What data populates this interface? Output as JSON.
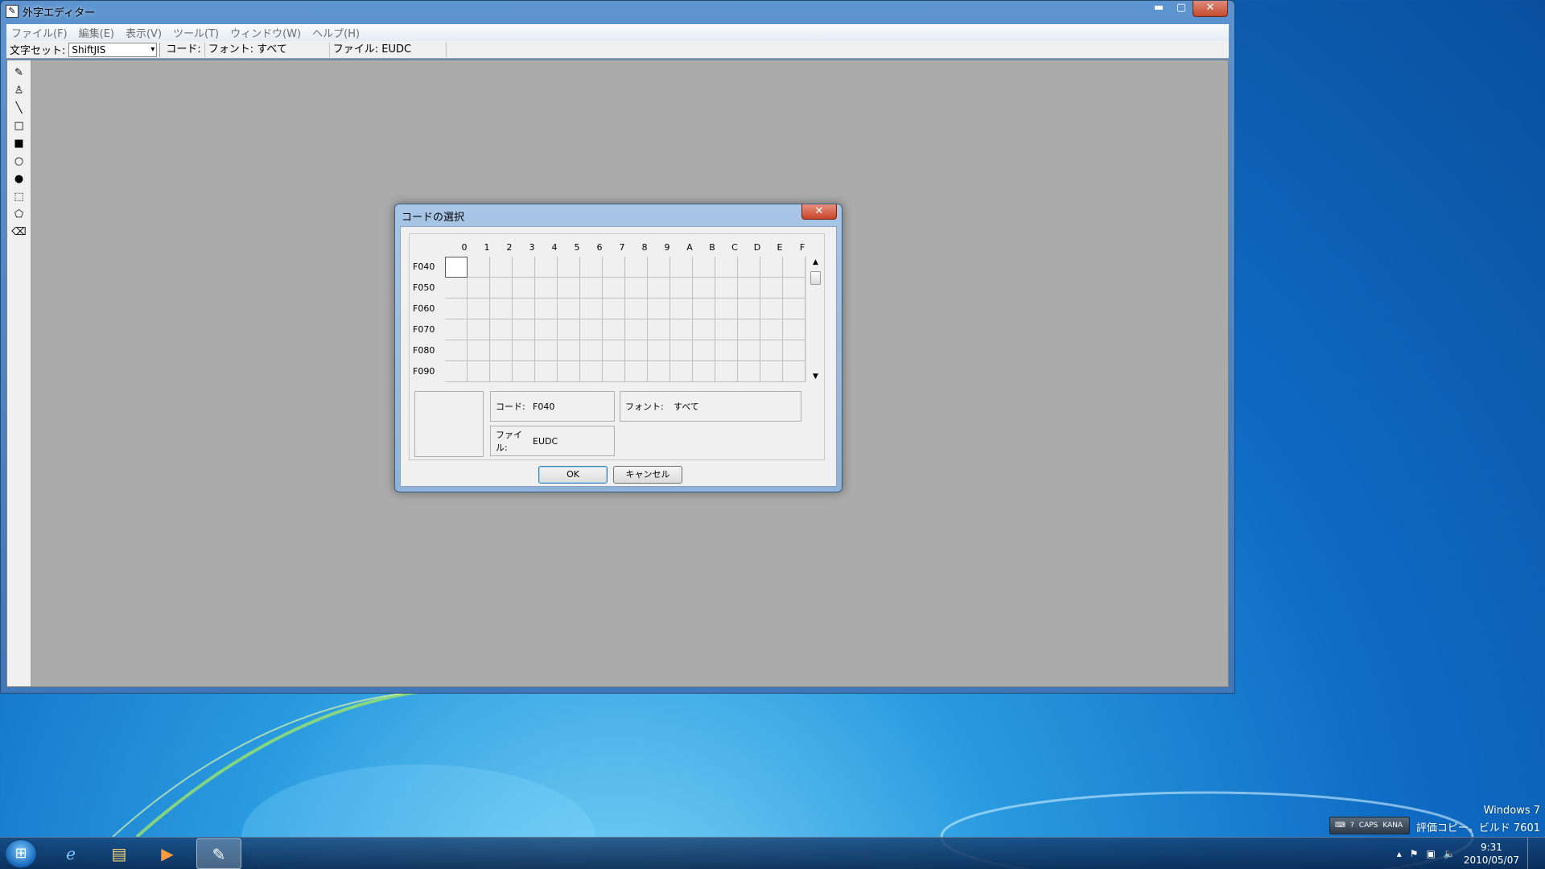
{
  "window": {
    "title": "外字エディター",
    "icon": "eudc-editor-icon",
    "controls": {
      "minimize": "▬",
      "maximize": "▢",
      "close": "✕"
    }
  },
  "menu": [
    "ファイル(F)",
    "編集(E)",
    "表示(V)",
    "ツール(T)",
    "ウィンドウ(W)",
    "ヘルプ(H)"
  ],
  "toolbar": {
    "charset_label": "文字セット:",
    "charset_value": "ShiftJIS",
    "code_label": "コード:",
    "font_label": "フォント: すべて",
    "file_label": "ファイル: EUDC"
  },
  "tools": [
    "pencil-icon",
    "brush-icon",
    "line-icon",
    "rectangle-outline-icon",
    "rectangle-filled-icon",
    "ellipse-outline-icon",
    "ellipse-filled-icon",
    "rect-select-icon",
    "freeform-select-icon",
    "eraser-icon"
  ],
  "dialog": {
    "title": "コードの選択",
    "columns": [
      "0",
      "1",
      "2",
      "3",
      "4",
      "5",
      "6",
      "7",
      "8",
      "9",
      "A",
      "B",
      "C",
      "D",
      "E",
      "F"
    ],
    "rows": [
      "F040",
      "F050",
      "F060",
      "F070",
      "F080",
      "F090"
    ],
    "code_key": "コード:",
    "code_value": "F040",
    "font_key": "フォント:",
    "font_value": "すべて",
    "file_key": "ファイル:",
    "file_value": "EUDC",
    "ok": "OK",
    "cancel": "キャンセル"
  },
  "desktop": {
    "watermark_line1": "Windows 7",
    "watermark_line2": "評価コピー。ビルド 7601",
    "ime_caps": "CAPS",
    "ime_kana": "KANA"
  },
  "taskbar": {
    "time": "9:31",
    "date": "2010/05/07"
  }
}
